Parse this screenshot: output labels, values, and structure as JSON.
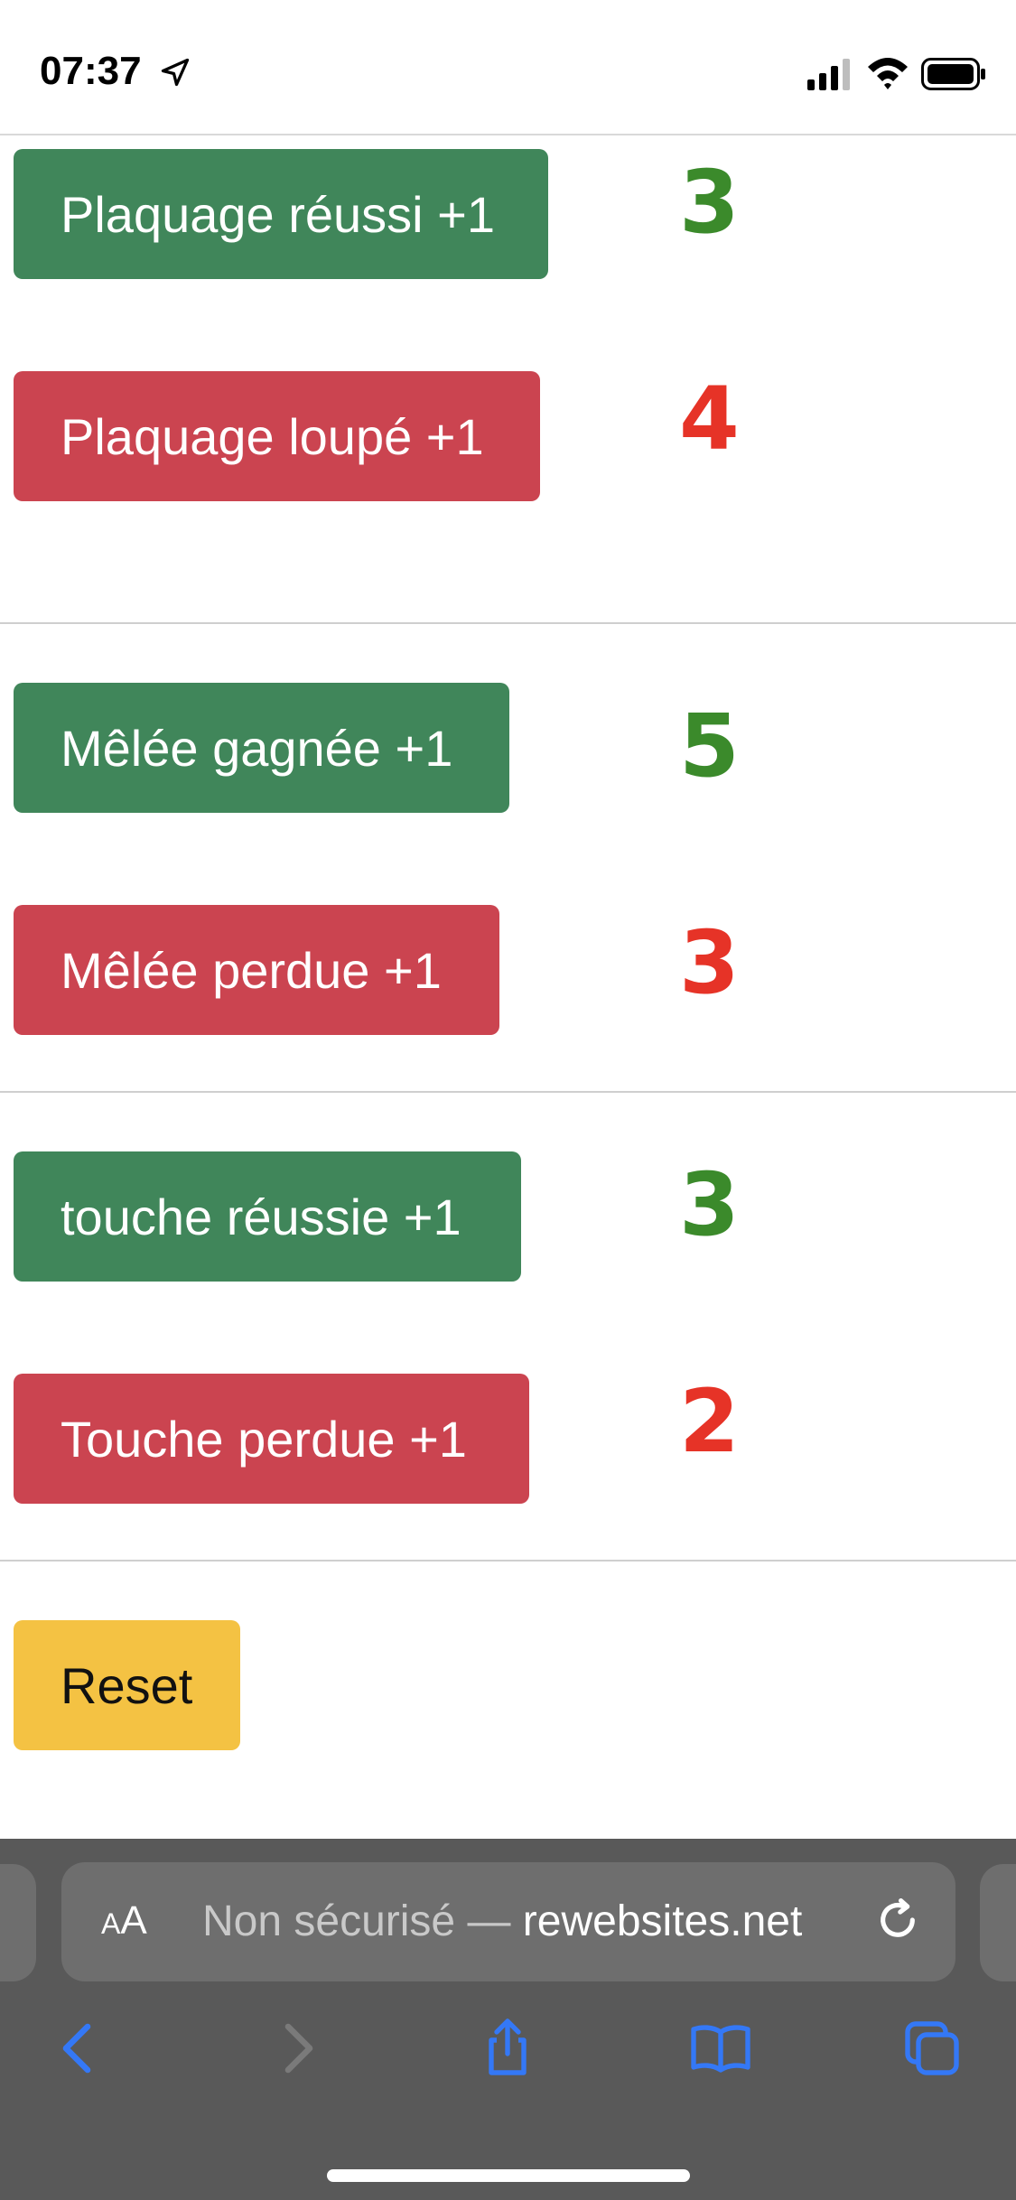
{
  "status_bar": {
    "time": "07:37"
  },
  "sections": [
    {
      "positive": {
        "label": "Plaquage réussi +1",
        "count": "3"
      },
      "negative": {
        "label": "Plaquage loupé +1",
        "count": "4"
      }
    },
    {
      "positive": {
        "label": "Mêlée gagnée +1",
        "count": "5"
      },
      "negative": {
        "label": "Mêlée perdue +1",
        "count": "3"
      }
    },
    {
      "positive": {
        "label": "touche réussie +1",
        "count": "3"
      },
      "negative": {
        "label": "Touche perdue +1",
        "count": "2"
      }
    }
  ],
  "reset_label": "Reset",
  "browser": {
    "aa_label_small": "A",
    "aa_label_big": "A",
    "url_prefix": "Non sécurisé — ",
    "url_host": "rewebsites.net"
  },
  "colors": {
    "positive_button": "#40865a",
    "negative_button": "#cb4450",
    "reset_button": "#f4c243",
    "positive_count": "#3b8a2b",
    "negative_count": "#e63327"
  }
}
